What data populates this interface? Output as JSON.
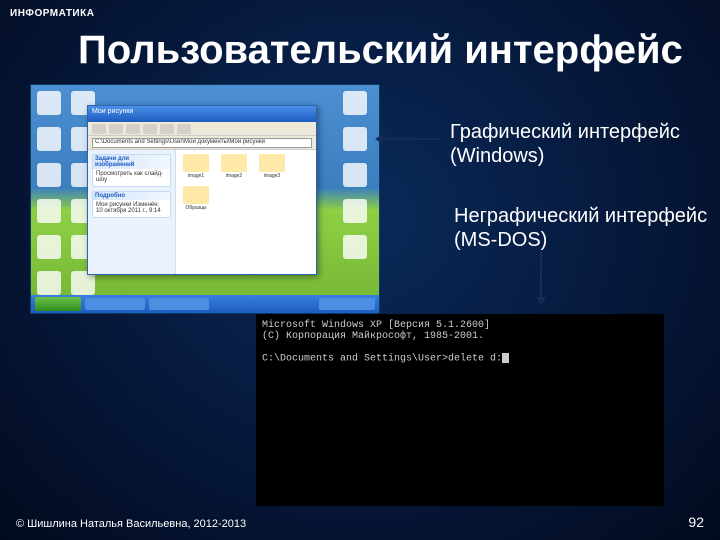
{
  "header": {
    "subject": "ИНФОРМАТИКА"
  },
  "title": "Пользовательский интерфейс",
  "labels": {
    "gui": {
      "name": "Графический интерфейс",
      "os": "(Windows)"
    },
    "cli": {
      "name": "Неграфический интерфейс",
      "os": "(MS-DOS)"
    }
  },
  "windows_screenshot": {
    "explorer": {
      "title": "Мои рисунки",
      "address": "C:\\Documents and Settings\\User\\Мои документы\\Мои рисунки",
      "side_panels": [
        {
          "header": "Задачи для изображений",
          "body": "Просмотреть как слайд-шоу"
        },
        {
          "header": "Подробно",
          "body": "Мои рисунки\nИзменён: 10 октября 2011 г., 9:14"
        }
      ],
      "files": [
        {
          "name": "image1"
        },
        {
          "name": "image2"
        },
        {
          "name": "image3"
        },
        {
          "name": "Образцы"
        }
      ]
    }
  },
  "dos_screenshot": {
    "lines": [
      "Microsoft Windows XP [Версия 5.1.2600]",
      "(С) Корпорация Майкрософт, 1985-2001.",
      "",
      "C:\\Documents and Settings\\User>delete d:"
    ]
  },
  "footer": {
    "copyright": "© Шишлина Наталья Васильевна, 2012-2013",
    "page": "92"
  }
}
